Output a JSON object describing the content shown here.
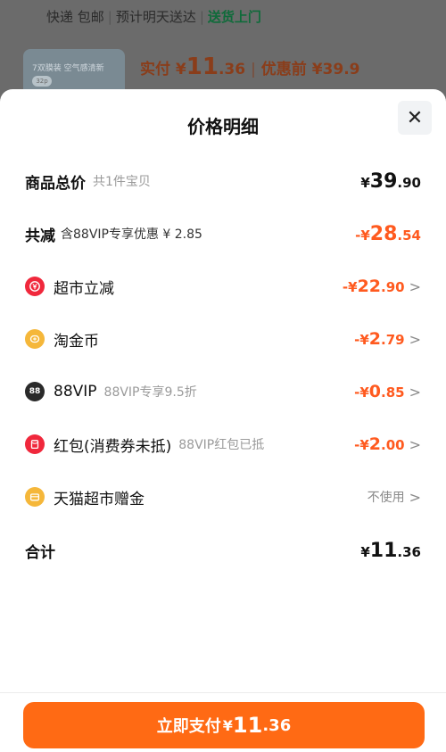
{
  "background": {
    "delivery": {
      "free_shipping": "快递 包邮",
      "eta": "预计明天送达",
      "door": "送货上门",
      "separator": "|"
    },
    "thumbnail_text": "7双膜装 空气感清新",
    "thumbnail_badge": "32p",
    "price": {
      "label": "实付 ¥",
      "int": "11",
      "dec": ".36",
      "separator": "|",
      "before": "优惠前 ¥39.9"
    }
  },
  "sheet": {
    "title": "价格明细",
    "close_icon": "close-icon"
  },
  "rows": {
    "total": {
      "label": "商品总价",
      "sub": "共1件宝贝",
      "cur": "¥",
      "int": "39",
      "dec": ".90"
    },
    "reduce": {
      "label": "共减",
      "sub": "含88VIP专享优惠 ¥ 2.85",
      "cur": "-¥",
      "int": "28",
      "dec": ".54"
    },
    "supermarket": {
      "label": "超市立减",
      "cur": "-¥",
      "int": "22",
      "dec": ".90",
      "chevron": ">"
    },
    "coin": {
      "label": "淘金币",
      "cur": "-¥",
      "int": "2",
      "dec": ".79",
      "chevron": ">"
    },
    "vip": {
      "icon_text": "88",
      "label": "88VIP",
      "sub": "88VIP专享9.5折",
      "cur": "-¥",
      "int": "0",
      "dec": ".85",
      "chevron": ">"
    },
    "redpacket": {
      "label": "红包(消费券未抵)",
      "sub": "88VIP红包已抵",
      "cur": "-¥",
      "int": "2",
      "dec": ".00",
      "chevron": ">"
    },
    "gift": {
      "label": "天猫超市赠金",
      "value": "不使用",
      "chevron": ">"
    },
    "sum": {
      "label": "合计",
      "cur": "¥",
      "int": "11",
      "dec": ".36"
    }
  },
  "pay_button": {
    "label": "立即支付",
    "cur": "¥",
    "int": "11",
    "dec": ".36"
  },
  "colors": {
    "accent": "#ff6a14",
    "discount": "#ff5a1f",
    "green": "#0f6b3a"
  }
}
